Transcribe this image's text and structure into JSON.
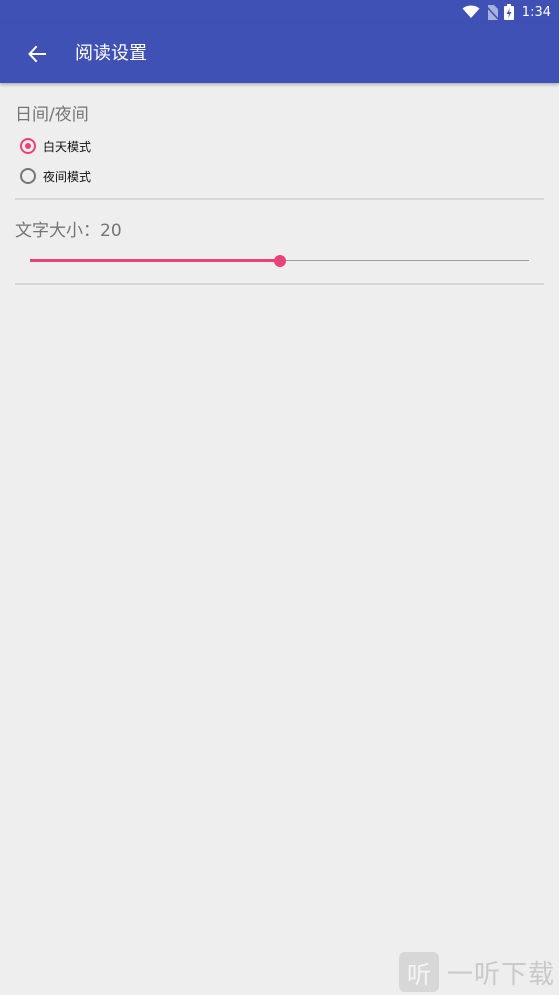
{
  "status_bar": {
    "time": "1:34",
    "icons": [
      "wifi-icon",
      "no-sim-icon",
      "battery-charging-icon"
    ]
  },
  "app_bar": {
    "back_icon": "arrow-left-icon",
    "title": "阅读设置"
  },
  "day_night": {
    "title": "日间/夜间",
    "options": [
      {
        "label": "白天模式",
        "checked": true
      },
      {
        "label": "夜间模式",
        "checked": false
      }
    ]
  },
  "font_size": {
    "title": "文字大小：20",
    "value_fraction": 0.5
  },
  "watermark": {
    "badge": "听",
    "text": "一听下载"
  },
  "colors": {
    "primary": "#3f51b5",
    "accent": "#ec407a",
    "background": "#eeeeee"
  }
}
